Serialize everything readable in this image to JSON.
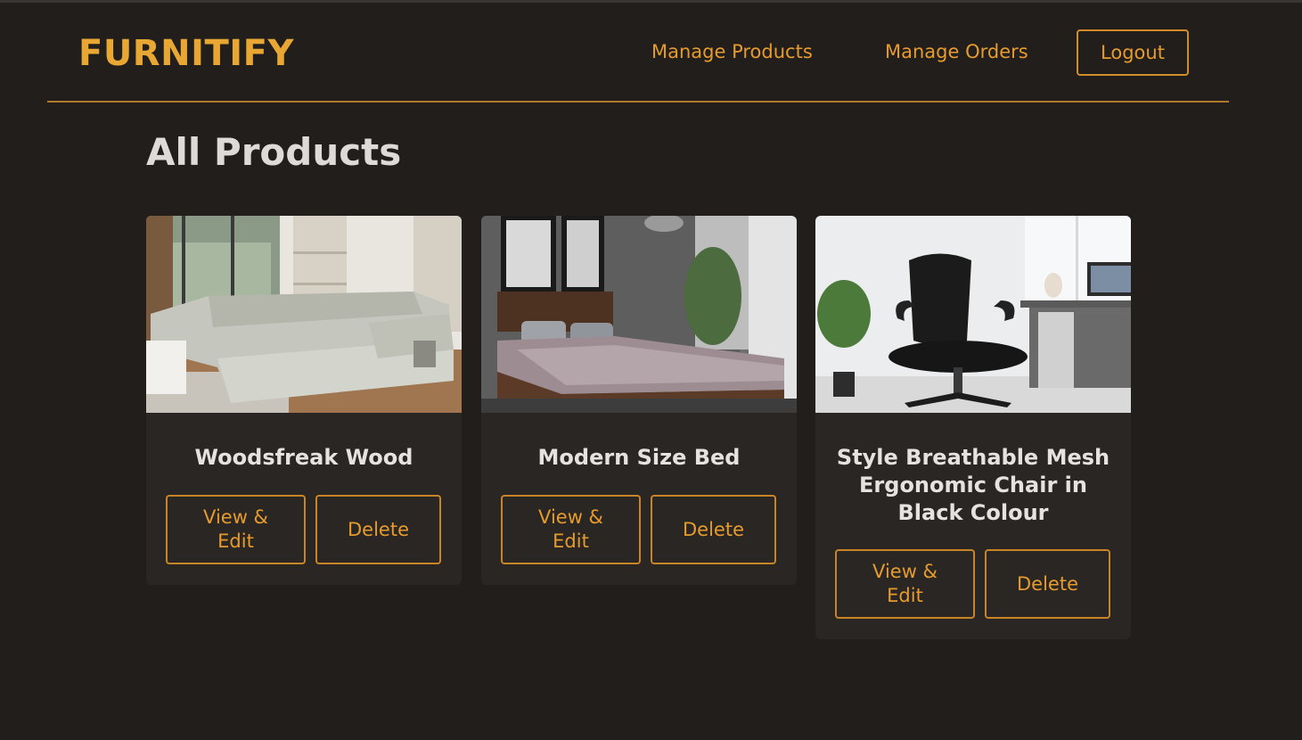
{
  "header": {
    "logo": "FURNITIFY",
    "nav": {
      "manage_products": "Manage Products",
      "manage_orders": "Manage Orders",
      "logout": "Logout"
    }
  },
  "page": {
    "title": "All Products"
  },
  "products": [
    {
      "title": "Woodsfreak Wood",
      "image": "sectional-sofa-photo",
      "edit_label": "View & Edit",
      "delete_label": "Delete"
    },
    {
      "title": "Modern Size Bed",
      "image": "wooden-bed-photo",
      "edit_label": "View & Edit",
      "delete_label": "Delete"
    },
    {
      "title": "Style Breathable Mesh Ergonomic Chair in Black Colour",
      "image": "office-chair-photo",
      "edit_label": "View & Edit",
      "delete_label": "Delete"
    }
  ],
  "colors": {
    "background": "#221e1c",
    "accent": "#e69b2e",
    "logo": "#e8a733",
    "card": "#2a2624",
    "title_text": "#dedad8"
  }
}
